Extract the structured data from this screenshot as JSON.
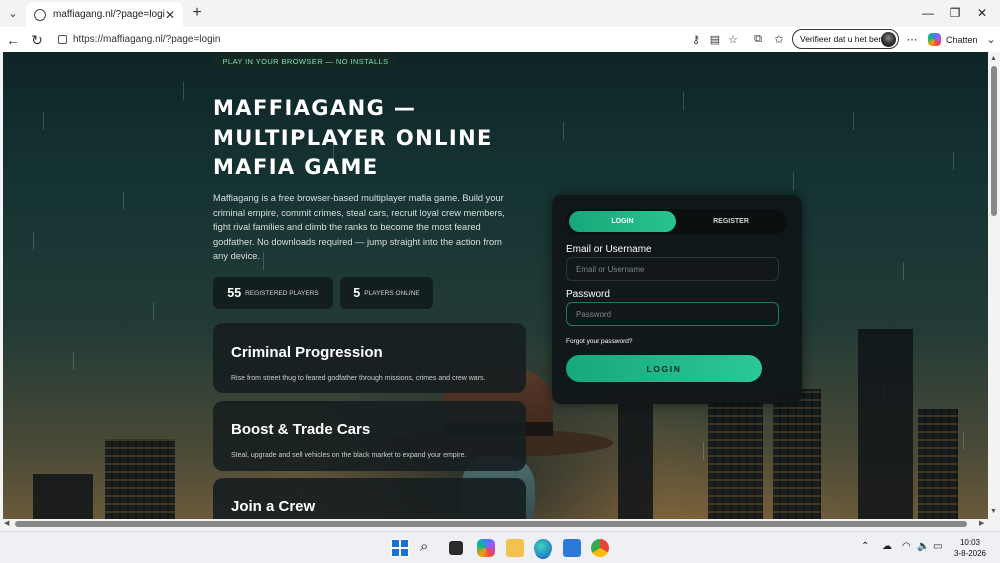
{
  "browser": {
    "tab_title": "maffiagang.nl/?page=login",
    "url": "https://maffiagang.nl/?page=login",
    "verify_pill": "Verifieer dat u het bent",
    "copilot_label": "Chatten"
  },
  "hero": {
    "badge": "PLAY IN YOUR BROWSER — NO INSTALLS",
    "title_line1": "MAFFIAGANG —",
    "title_line2": "MULTIPLAYER ONLINE",
    "title_line3": "MAFIA GAME",
    "description": "Maffiagang is a free browser-based multiplayer mafia game. Build your criminal empire, commit crimes, steal cars, recruit loyal crew members, fight rival families and climb the ranks to become the most feared godfather. No downloads required — jump straight into the action from any device."
  },
  "stats": [
    {
      "value": "55",
      "label": "Registered Players"
    },
    {
      "value": "5",
      "label": "Players Online"
    }
  ],
  "features": [
    {
      "title": "Criminal Progression",
      "description": "Rise from street thug to feared godfather through missions, crimes and crew wars."
    },
    {
      "title": "Boost & Trade Cars",
      "description": "Steal, upgrade and sell vehicles on the black market to expand your empire."
    },
    {
      "title": "Join a Crew",
      "description": ""
    }
  ],
  "auth": {
    "tab_login": "LOGIN",
    "tab_register": "REGISTER",
    "active_tab": "login",
    "email_label": "Email or Username",
    "email_placeholder": "Email or Username",
    "password_label": "Password",
    "password_placeholder": "Password",
    "forgot": "Forgot your password?",
    "submit": "LOGIN"
  },
  "taskbar": {
    "time": "10:03",
    "date": "3-8-2026"
  },
  "icons": [
    "tab-list-icon",
    "globe-icon",
    "close-icon",
    "plus-icon",
    "back-icon",
    "refresh-icon",
    "lock-icon",
    "key-icon",
    "reader-icon",
    "star-icon",
    "extensions-icon",
    "favorites-icon",
    "more-icon",
    "copilot-icon",
    "chevron-down-icon",
    "windows-icon",
    "search-icon",
    "wifi-icon",
    "volume-icon",
    "battery-icon"
  ]
}
